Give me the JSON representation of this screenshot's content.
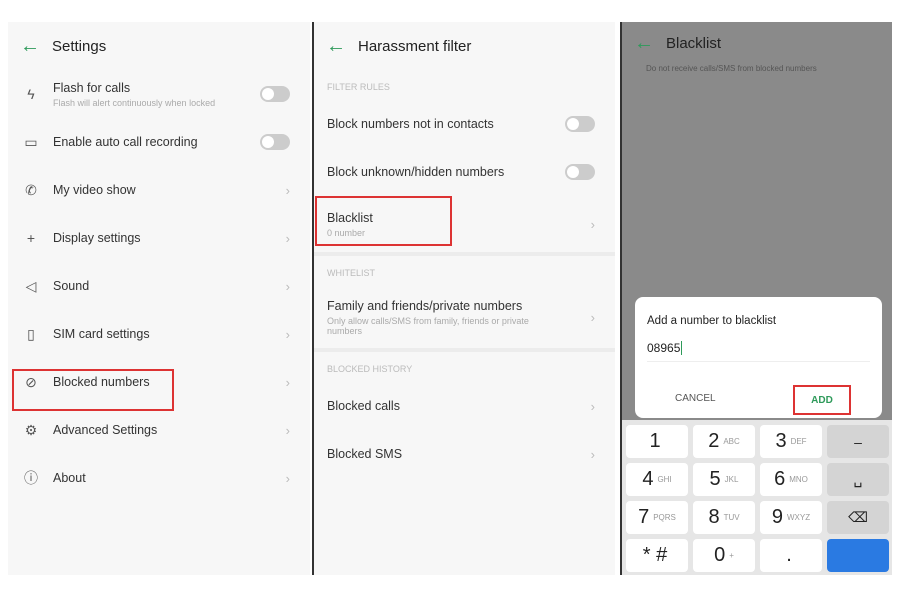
{
  "settings": {
    "title": "Settings",
    "items": [
      {
        "label": "Flash for calls",
        "sub": "Flash will alert continuously when locked",
        "control": "toggle",
        "icon": "flash-icon"
      },
      {
        "label": "Enable auto call recording",
        "control": "toggle",
        "icon": "recording-icon"
      },
      {
        "label": "My video show",
        "control": "chevron",
        "icon": "video-call-icon"
      },
      {
        "label": "Display settings",
        "control": "chevron",
        "icon": "plus-icon"
      },
      {
        "label": "Sound",
        "control": "chevron",
        "icon": "speaker-icon"
      },
      {
        "label": "SIM card settings",
        "control": "chevron",
        "icon": "sim-icon"
      },
      {
        "label": "Blocked numbers",
        "control": "chevron",
        "icon": "block-icon",
        "highlighted": true
      },
      {
        "label": "Advanced Settings",
        "control": "chevron",
        "icon": "gear-icon"
      },
      {
        "label": "About",
        "control": "chevron",
        "icon": "info-icon"
      }
    ]
  },
  "harassment": {
    "title": "Harassment filter",
    "filter_rules": "FILTER RULES",
    "block_not_contacts": "Block numbers not in contacts",
    "block_unknown": "Block unknown/hidden numbers",
    "blacklist": "Blacklist",
    "blacklist_sub": "0 number",
    "whitelist": "WHITELIST",
    "family": "Family and friends/private numbers",
    "family_sub": "Only allow calls/SMS from family, friends or private numbers",
    "blocked_history": "BLOCKED HISTORY",
    "blocked_calls": "Blocked calls",
    "blocked_sms": "Blocked SMS"
  },
  "blacklist": {
    "title": "Blacklist",
    "desc": "Do not receive calls/SMS from blocked numbers",
    "dialog": {
      "title": "Add a number to blacklist",
      "value": "08965",
      "cancel": "CANCEL",
      "add": "ADD"
    }
  },
  "keypad": {
    "keys": [
      [
        "1",
        ""
      ],
      [
        "2",
        "ABC"
      ],
      [
        "3",
        "DEF"
      ],
      [
        "4",
        "GHI"
      ],
      [
        "5",
        "JKL"
      ],
      [
        "6",
        "MNO"
      ],
      [
        "7",
        "PQRS"
      ],
      [
        "8",
        "TUV"
      ],
      [
        "9",
        "WXYZ"
      ],
      [
        "* #",
        ""
      ],
      [
        "0",
        "+"
      ],
      [
        ".",
        ""
      ]
    ],
    "side": [
      "–",
      "␣",
      "⌫",
      ""
    ]
  },
  "colors": {
    "accent": "#2e9a5a",
    "highlight": "#d33333",
    "key_blue": "#2a7ae2"
  }
}
